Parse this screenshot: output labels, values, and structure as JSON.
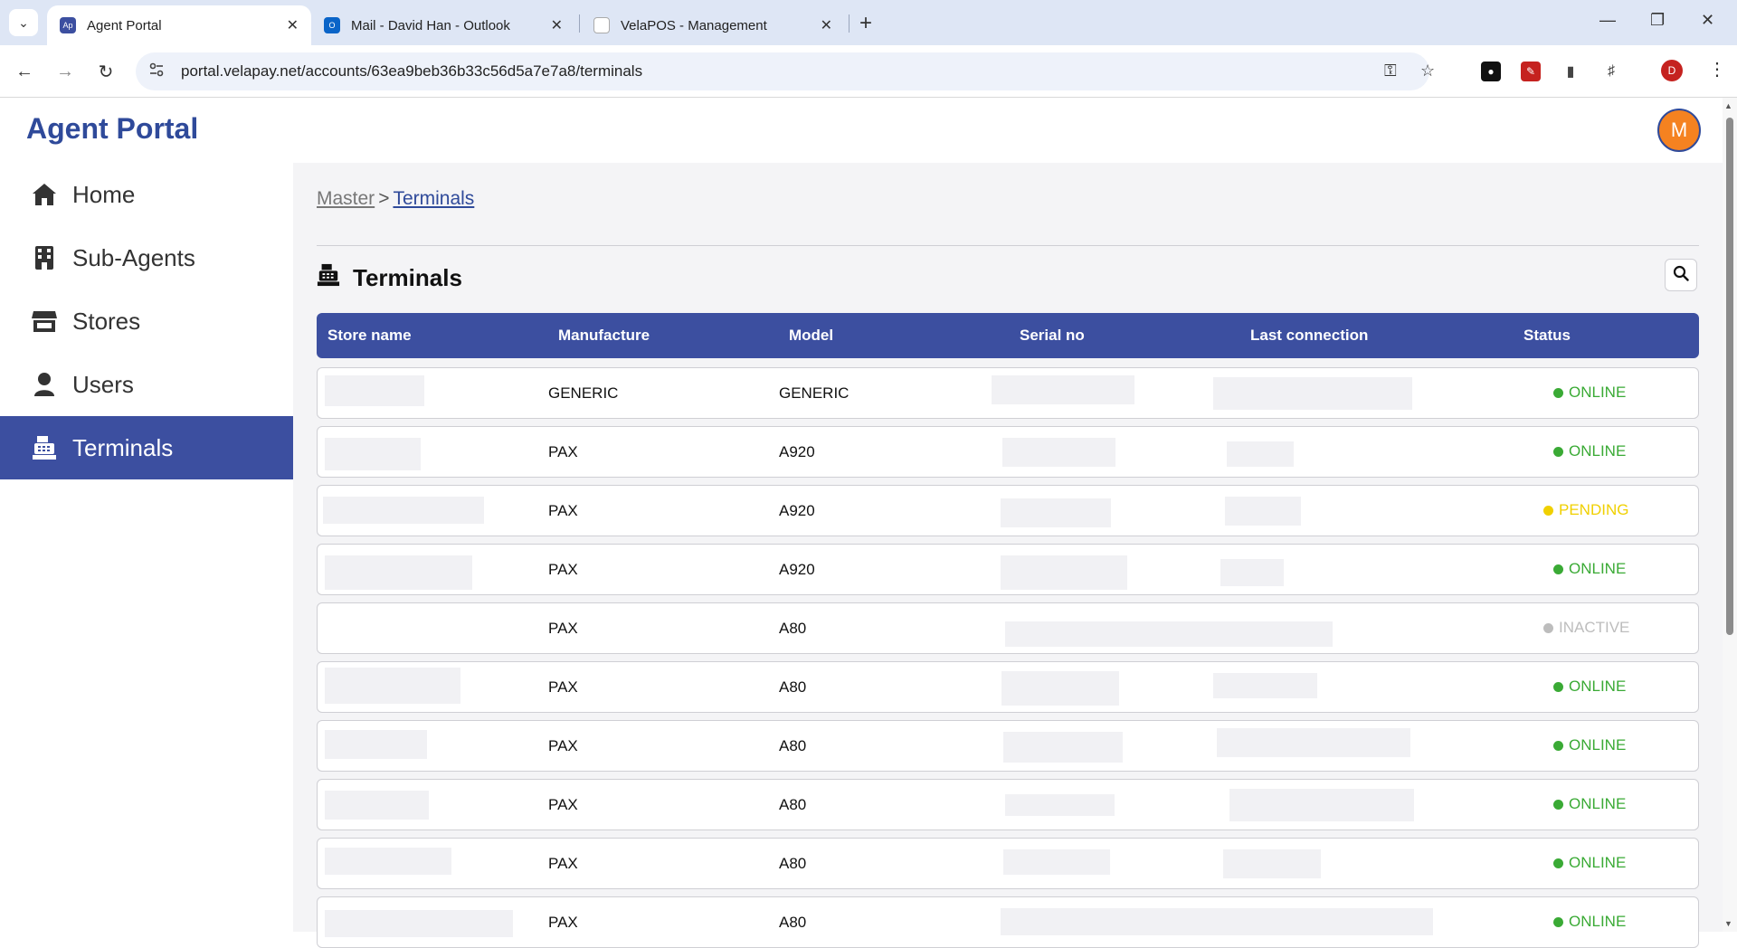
{
  "browser": {
    "tabs": [
      {
        "title": "Agent Portal",
        "favicon": "Ap",
        "favicon_color": "#3c4fa0",
        "active": true
      },
      {
        "title": "Mail - David Han - Outlook",
        "favicon": "O",
        "favicon_color": "#0a64c8",
        "active": false
      },
      {
        "title": "VelaPOS - Management",
        "favicon": "",
        "favicon_color": "#ffffff",
        "active": false
      }
    ],
    "url": "portal.velapay.net/accounts/63ea9beb36b33c56d5a7e7a8/terminals",
    "profile_initial": "D"
  },
  "app": {
    "brand": "Agent Portal",
    "avatar_initial": "M",
    "accent": "#3c4fa0",
    "avatar_color": "#f58220"
  },
  "sidebar": {
    "items": [
      {
        "label": "Home",
        "icon": "home-icon",
        "active": false
      },
      {
        "label": "Sub-Agents",
        "icon": "building-icon",
        "active": false
      },
      {
        "label": "Stores",
        "icon": "store-icon",
        "active": false
      },
      {
        "label": "Users",
        "icon": "user-icon",
        "active": false
      },
      {
        "label": "Terminals",
        "icon": "cash-register-icon",
        "active": true
      }
    ]
  },
  "breadcrumb": {
    "root": "Master",
    "separator": ">",
    "current": "Terminals"
  },
  "page": {
    "title": "Terminals"
  },
  "table": {
    "columns": [
      "Store name",
      "Manufacture",
      "Model",
      "Serial no",
      "Last connection",
      "Status"
    ],
    "rows": [
      {
        "manufacture": "GENERIC",
        "model": "GENERIC",
        "status": "ONLINE"
      },
      {
        "manufacture": "PAX",
        "model": "A920",
        "status": "ONLINE"
      },
      {
        "manufacture": "PAX",
        "model": "A920",
        "status": "PENDING"
      },
      {
        "manufacture": "PAX",
        "model": "A920",
        "status": "ONLINE"
      },
      {
        "manufacture": "PAX",
        "model": "A80",
        "status": "INACTIVE"
      },
      {
        "manufacture": "PAX",
        "model": "A80",
        "status": "ONLINE"
      },
      {
        "manufacture": "PAX",
        "model": "A80",
        "status": "ONLINE"
      },
      {
        "manufacture": "PAX",
        "model": "A80",
        "status": "ONLINE"
      },
      {
        "manufacture": "PAX",
        "model": "A80",
        "status": "ONLINE"
      },
      {
        "manufacture": "PAX",
        "model": "A80",
        "status": "ONLINE"
      }
    ],
    "status_colors": {
      "ONLINE": "#3aaa35",
      "PENDING": "#f0d000",
      "INACTIVE": "#bdbdbd"
    }
  }
}
